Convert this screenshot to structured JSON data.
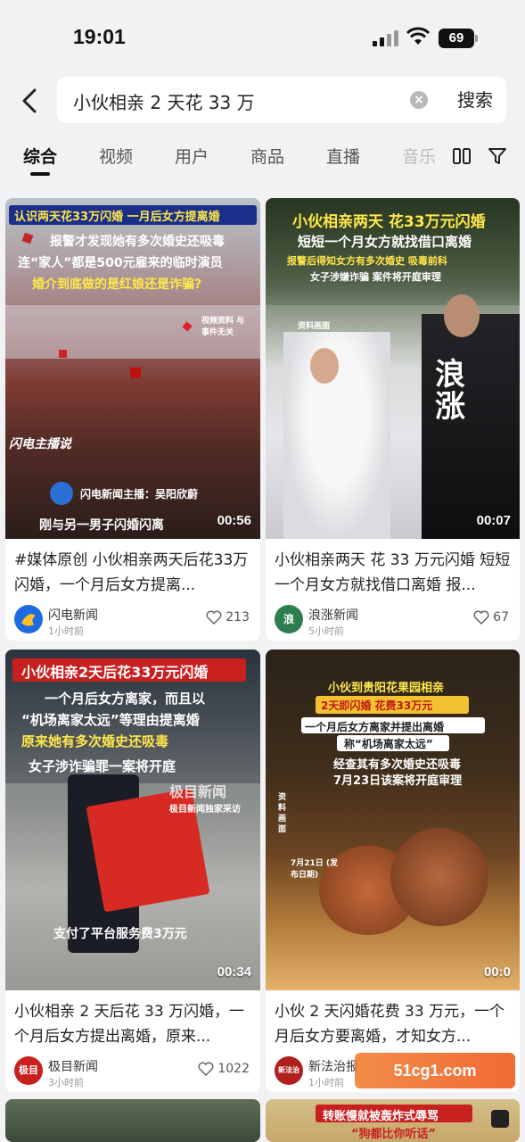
{
  "status": {
    "time": "19:01",
    "battery": "69"
  },
  "search": {
    "query": "小伙相亲 2 天花 33 万",
    "button": "搜索"
  },
  "tabs": [
    "综合",
    "视频",
    "用户",
    "商品",
    "直播",
    "音乐"
  ],
  "cards": [
    {
      "overlay": [
        "认识两天花33万闪婚 一月后女方提离婚",
        "报警才发现她有多次婚史还吸毒",
        "连“家人”都是500元雇来的临时演员",
        "婚介到底做的是红娘还是诈骗?"
      ],
      "badge": "闪电主播说",
      "anchor": "闪电新闻主播：吴阳欣蔚",
      "caption": "刚与另一男子闪婚闪离",
      "watermark": "视频资料 与事件无关",
      "duration": "00:56",
      "title": "#媒体原创 小伙相亲两天后花33万闪婚，一个月后女方提离...",
      "author": "闪电新闻",
      "time": "1小时前",
      "likes": "213"
    },
    {
      "overlay": [
        "小伙相亲两天 花33万元闪婚",
        "短短一个月女方就找借口离婚",
        "报警后得知女方有多次婚史 吸毒前科",
        "女子涉嫌诈骗 案件将开庭审理"
      ],
      "label": "资料画面",
      "logo": "浪涨",
      "duration": "00:07",
      "title": "小伙相亲两天 花 33 万元闪婚 短短一个月女方就找借口离婚 报...",
      "author": "浪涨新闻",
      "time": "5小时前",
      "likes": "67"
    },
    {
      "overlay": [
        "小伙相亲2天后花33万元闪婚",
        "一个月后女方离家，而且以",
        "“机场离家太远”等理由提离婚",
        "原来她有多次婚史还吸毒",
        "女子涉诈骗罪一案将开庭"
      ],
      "watermark": "极目新闻",
      "source": "极目新闻独家采访",
      "caption": "支付了平台服务费3万元",
      "duration": "00:34",
      "title": "小伙相亲 2 天后花 33 万闪婚，一个月后女方提出离婚，原来...",
      "author": "极目新闻",
      "time": "3小时前",
      "likes": "1022"
    },
    {
      "overlay": [
        "小伙到贵阳花果园相亲",
        "2天即闪婚 花费33万元",
        "一个月后女方离家并提出离婚",
        "称“机场离家太远”",
        "经查其有多次婚史还吸毒",
        "7月23日该案将开庭审理"
      ],
      "label": "资料画面",
      "date": "7月21日 (发布日期)",
      "duration": "00:0",
      "title": "小伙 2 天闪婚花费 33 万元，一个月后女方要离婚，才知女方...",
      "author": "新法治报",
      "time": "1小时前",
      "likes": ""
    }
  ],
  "bottom_cards": [
    {
      "overlay": []
    },
    {
      "overlay": [
        "转账慢就被轰炸式辱骂",
        "“狗都比你听话”"
      ]
    }
  ],
  "watermark_site": "51cg1.com"
}
